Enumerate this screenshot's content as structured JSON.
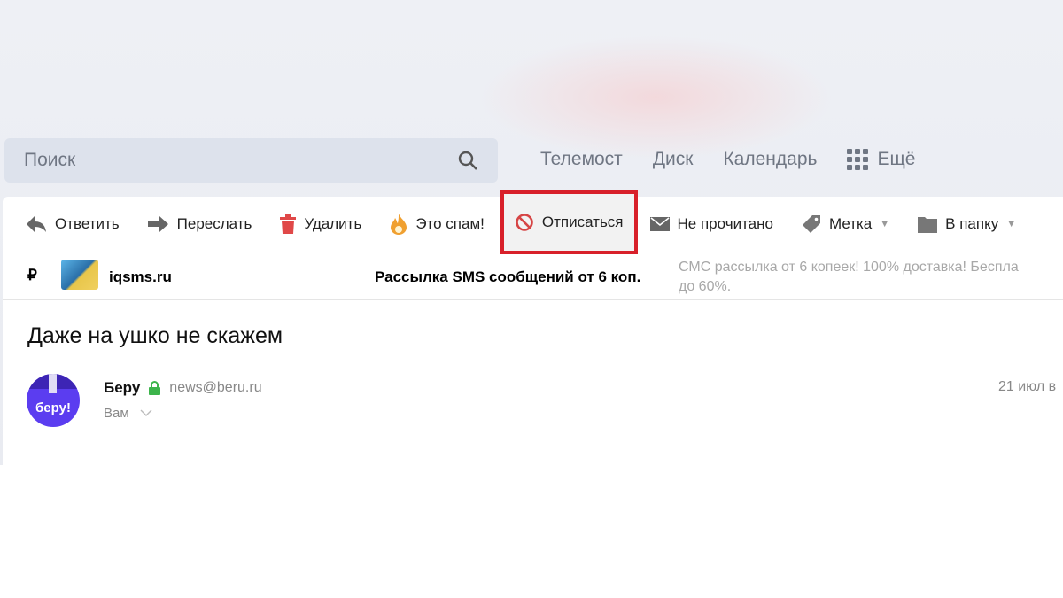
{
  "search": {
    "placeholder": "Поиск"
  },
  "topnav": [
    "Телемост",
    "Диск",
    "Календарь",
    "Ещё"
  ],
  "toolbar": {
    "reply": "Ответить",
    "forward": "Переслать",
    "delete": "Удалить",
    "spam": "Это спам!",
    "unsubscribe": "Отписаться",
    "unread": "Не прочитано",
    "label": "Метка",
    "folder": "В папку"
  },
  "ad": {
    "currency": "₽",
    "name": "iqsms.ru",
    "title": "Рассылка SMS сообщений от 6 коп.",
    "description": "СМС рассылка от 6 копеек! 100% доставка! Беспла",
    "description2": "до 60%."
  },
  "message": {
    "subject": "Даже на ушко не скажем",
    "sender": "Беру",
    "email": "news@beru.ru",
    "to": "Вам",
    "date": "21 июл в",
    "avatar_text": "беру!"
  },
  "colors": {
    "highlight": "#d8202a",
    "avatar": "#5b3df0"
  }
}
